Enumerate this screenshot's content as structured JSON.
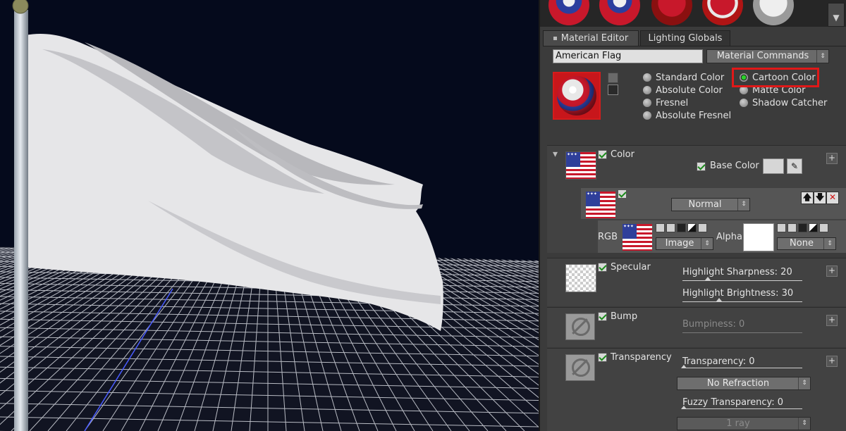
{
  "tabs": {
    "material_editor": "Material Editor",
    "lighting_globals": "Lighting Globals"
  },
  "material_name": "American Flag",
  "material_commands": "Material Commands",
  "radio_options": {
    "standard": "Standard Color",
    "absolute": "Absolute Color",
    "fresnel": "Fresnel",
    "absolute_fresnel": "Absolute Fresnel",
    "cartoon": "Cartoon Color",
    "matte": "Matte Color",
    "shadow_catcher": "Shadow Catcher"
  },
  "selected_option": "Cartoon Color",
  "color_section": {
    "title": "Color",
    "base_color_label": "Base Color",
    "blend_mode": "Normal",
    "rgb_label": "RGB",
    "rgb_source": "Image",
    "alpha_label": "Alpha",
    "alpha_source": "None"
  },
  "specular_section": {
    "title": "Specular",
    "highlight_sharpness": "Highlight Sharpness: 20",
    "highlight_brightness": "Highlight Brightness: 30"
  },
  "bump_section": {
    "title": "Bump",
    "bumpiness": "Bumpiness: 0"
  },
  "transparency_section": {
    "title": "Transparency",
    "transparency": "Transparency: 0",
    "refraction": "No Refraction",
    "fuzzy": "Fuzzy Transparency: 0",
    "ray": "1 ray"
  },
  "icons": {
    "plus": "+",
    "up": "🡅",
    "down": "🡇",
    "close": "✕",
    "dropdown": "⇕",
    "scroll_down": "▼",
    "collapse": "▾",
    "eyedropper": "✎"
  },
  "colors": {
    "highlight": "#e01818",
    "radio_on": "#2bd02b",
    "viewport_bg": "#050a1c"
  }
}
